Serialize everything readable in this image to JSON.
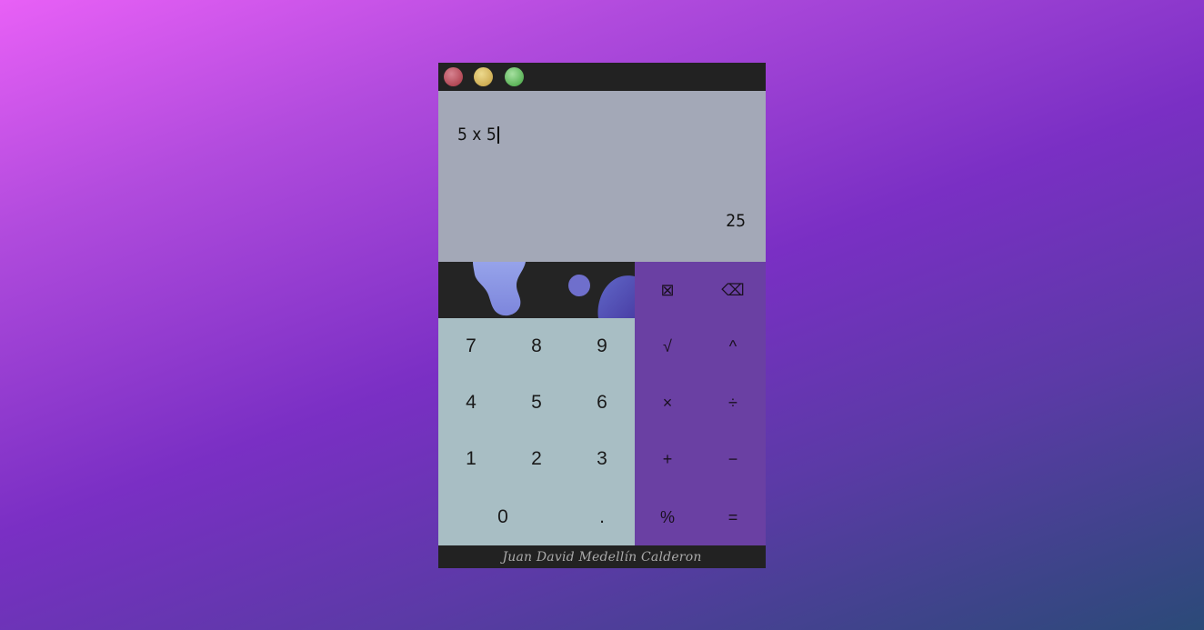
{
  "window": {
    "buttons": [
      "close",
      "minimize",
      "maximize"
    ],
    "colors": {
      "close": "#b34956",
      "minimize": "#cfae55",
      "maximize": "#5db45a"
    }
  },
  "display": {
    "expression": "5 x 5",
    "result": "25"
  },
  "number_keys": [
    {
      "label": "7"
    },
    {
      "label": "8"
    },
    {
      "label": "9"
    },
    {
      "label": "4"
    },
    {
      "label": "5"
    },
    {
      "label": "6"
    },
    {
      "label": "1"
    },
    {
      "label": "2"
    },
    {
      "label": "3"
    },
    {
      "label": "0"
    },
    {
      "label": "."
    }
  ],
  "operator_keys": [
    {
      "label": "⊠",
      "action": "clear"
    },
    {
      "label": "⌫",
      "action": "backspace"
    },
    {
      "label": "√",
      "action": "sqrt"
    },
    {
      "label": "^",
      "action": "power"
    },
    {
      "label": "×",
      "action": "multiply"
    },
    {
      "label": "÷",
      "action": "divide"
    },
    {
      "label": "+",
      "action": "add"
    },
    {
      "label": "−",
      "action": "subtract"
    },
    {
      "label": "%",
      "action": "percent"
    },
    {
      "label": "=",
      "action": "equals"
    }
  ],
  "footer": {
    "author": "Juan David Medellín Calderon"
  },
  "colors": {
    "titlebar": "#222222",
    "display_bg": "#a3a8b7",
    "numpad_bg": "#a8bec4",
    "operator_bg": "#6a40a3",
    "decor_blob": "#8f9ae6"
  }
}
